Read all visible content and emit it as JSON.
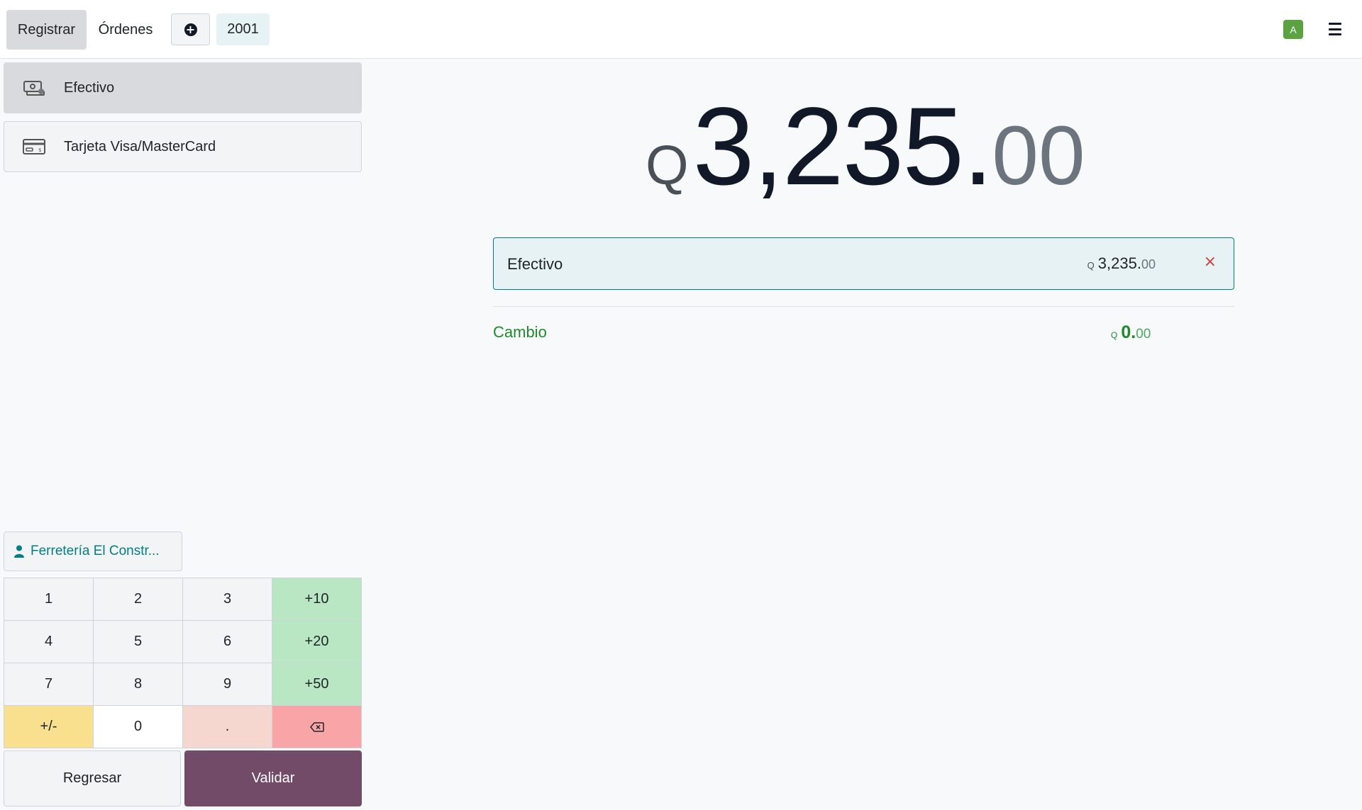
{
  "nav": {
    "register_label": "Registrar",
    "orders_label": "Órdenes",
    "order_number": "2001",
    "avatar_letter": "A"
  },
  "payment_methods": [
    {
      "label": "Efectivo",
      "icon": "cash-icon",
      "selected": true
    },
    {
      "label": "Tarjeta Visa/MasterCard",
      "icon": "card-icon",
      "selected": false
    }
  ],
  "customer": {
    "name": "Ferretería El Constr..."
  },
  "numpad": {
    "keys": [
      "1",
      "2",
      "3",
      "+10",
      "4",
      "5",
      "6",
      "+20",
      "7",
      "8",
      "9",
      "+50",
      "+/-",
      "0",
      ".",
      "backspace"
    ]
  },
  "actions": {
    "back_label": "Regresar",
    "validate_label": "Validar"
  },
  "total": {
    "currency": "Q",
    "integer": "3,235.",
    "decimals": "00"
  },
  "payment_line": {
    "method": "Efectivo",
    "currency": "Q",
    "integer": "3,235.",
    "decimals": "00",
    "remove_symbol": "×"
  },
  "change": {
    "label": "Cambio",
    "currency": "Q",
    "integer": "0.",
    "decimals": "00"
  },
  "colors": {
    "accent": "#017e84",
    "validate": "#714b67",
    "success": "#1e8a2c",
    "avatar": "#5ba340"
  }
}
